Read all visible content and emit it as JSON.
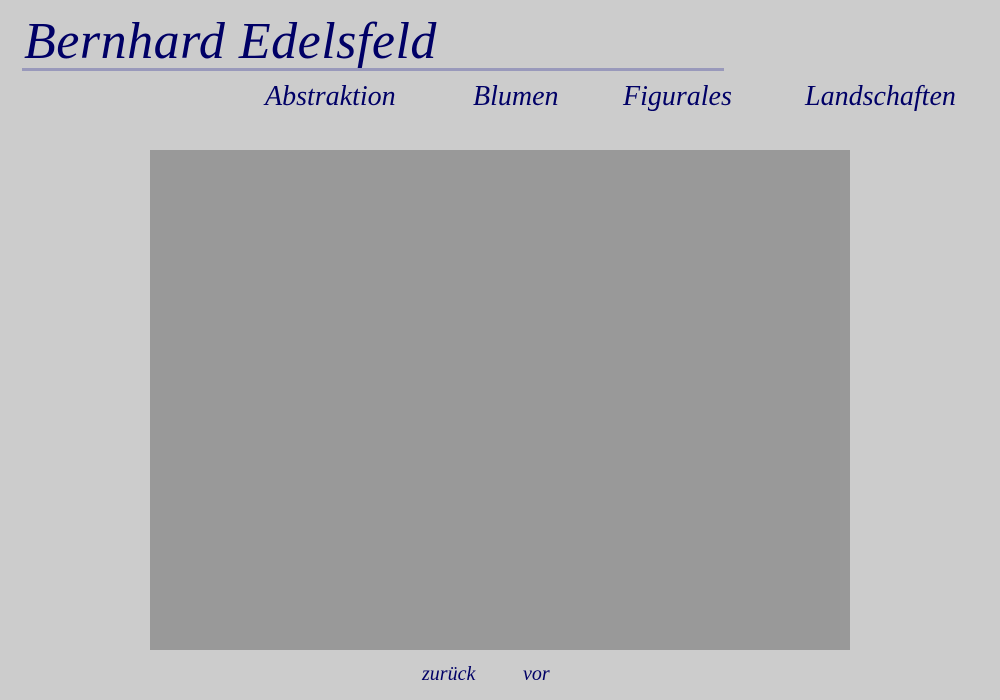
{
  "header": {
    "title": "Bernhard Edelsfeld"
  },
  "nav": {
    "items": [
      {
        "label": "Abstraktion"
      },
      {
        "label": "Blumen"
      },
      {
        "label": "Figurales"
      },
      {
        "label": "Landschaften"
      }
    ]
  },
  "gallery": {
    "placeholder_color": "#999999"
  },
  "pager": {
    "back_label": "zurück",
    "next_label": "vor"
  },
  "colors": {
    "background": "#cccccc",
    "text": "#000066",
    "rule": "#9999bb"
  }
}
